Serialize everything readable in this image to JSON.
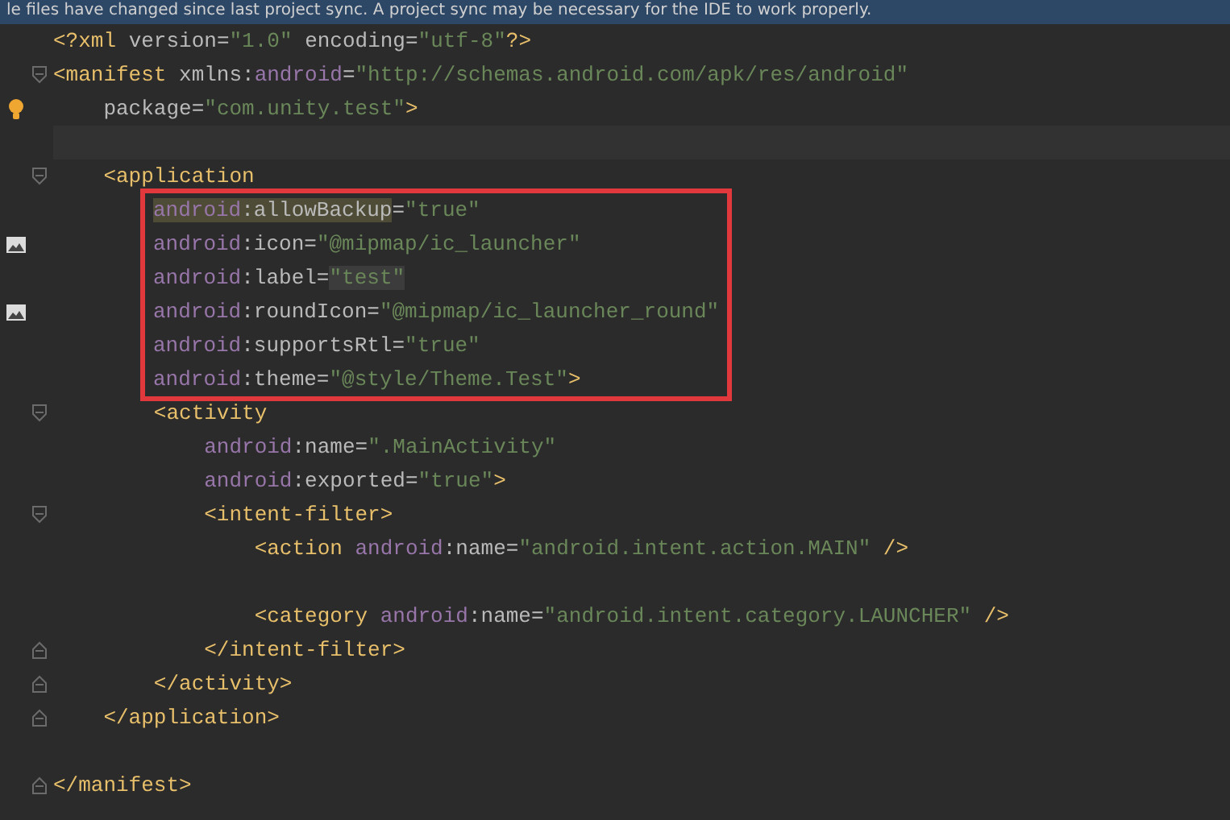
{
  "notification": {
    "text": "le files have changed since last project sync. A project sync may be necessary for the IDE to work properly."
  },
  "sections": [
    {
      "lines": [
        {
          "tokens": [
            {
              "kind": "tag",
              "text": "<?xml"
            },
            {
              "kind": "attr",
              "text": " version"
            },
            {
              "kind": "punct",
              "text": "="
            },
            {
              "kind": "value",
              "text": "\"1.0\""
            },
            {
              "kind": "attr",
              "text": " encoding"
            },
            {
              "kind": "punct",
              "text": "="
            },
            {
              "kind": "value",
              "text": "\"utf-8\""
            },
            {
              "kind": "tag",
              "text": "?>"
            }
          ]
        },
        {
          "fold": {
            "kind": "open"
          },
          "tokens": [
            {
              "kind": "tag",
              "text": "<manifest"
            },
            {
              "kind": "attr",
              "text": " xmlns:"
            },
            {
              "kind": "ns",
              "text": "android"
            },
            {
              "kind": "punct",
              "text": "="
            },
            {
              "kind": "value",
              "text": "\"http://schemas.android.com/apk/res/android\""
            }
          ]
        },
        {
          "gutter": {
            "kind": "bulb"
          },
          "tokens": [
            {
              "kind": "attr",
              "text": "    package"
            },
            {
              "kind": "punct",
              "text": "="
            },
            {
              "kind": "value",
              "text": "\"com.unity.test\""
            },
            {
              "kind": "tag",
              "text": ">"
            }
          ]
        },
        {
          "current": true
        },
        {
          "fold": {
            "kind": "open"
          },
          "tokens": [
            {
              "kind": "tag",
              "text": "    <application"
            }
          ]
        }
      ]
    },
    {
      "boxed": true,
      "lines": [
        {
          "tokens": [
            {
              "kind": "ns",
              "text": "android",
              "highlight": true
            },
            {
              "kind": "attr",
              "text": ":allowBackup",
              "highlight": true
            },
            {
              "kind": "punct",
              "text": "="
            },
            {
              "kind": "value",
              "text": "\"true\""
            }
          ]
        },
        {
          "gutter": {
            "kind": "image"
          },
          "tokens": [
            {
              "kind": "ns",
              "text": "android"
            },
            {
              "kind": "attr",
              "text": ":icon"
            },
            {
              "kind": "punct",
              "text": "="
            },
            {
              "kind": "value",
              "text": "\"@mipmap/ic_launcher\""
            }
          ]
        },
        {
          "tokens": [
            {
              "kind": "ns",
              "text": "android"
            },
            {
              "kind": "attr",
              "text": ":label"
            },
            {
              "kind": "punct",
              "text": "="
            },
            {
              "kind": "value",
              "text": "\"test\"",
              "highlight": true
            }
          ]
        },
        {
          "gutter": {
            "kind": "image"
          },
          "tokens": [
            {
              "kind": "ns",
              "text": "android"
            },
            {
              "kind": "attr",
              "text": ":roundIcon"
            },
            {
              "kind": "punct",
              "text": "="
            },
            {
              "kind": "value",
              "text": "\"@mipmap/ic_launcher_round\""
            }
          ]
        },
        {
          "tokens": [
            {
              "kind": "ns",
              "text": "android"
            },
            {
              "kind": "attr",
              "text": ":supportsRtl"
            },
            {
              "kind": "punct",
              "text": "="
            },
            {
              "kind": "value",
              "text": "\"true\""
            }
          ]
        },
        {
          "tokens": [
            {
              "kind": "ns",
              "text": "android"
            },
            {
              "kind": "attr",
              "text": ":theme"
            },
            {
              "kind": "punct",
              "text": "="
            },
            {
              "kind": "value",
              "text": "\"@style/Theme.Test\""
            },
            {
              "kind": "tag",
              "text": ">"
            }
          ]
        }
      ]
    },
    {
      "lines": [
        {
          "fold": {
            "kind": "open"
          },
          "tokens": [
            {
              "kind": "tag",
              "text": "        <activity"
            }
          ]
        },
        {
          "tokens": [
            {
              "kind": "ns",
              "text": "            android"
            },
            {
              "kind": "attr",
              "text": ":name"
            },
            {
              "kind": "punct",
              "text": "="
            },
            {
              "kind": "value",
              "text": "\".MainActivity\""
            }
          ]
        },
        {
          "tokens": [
            {
              "kind": "ns",
              "text": "            android"
            },
            {
              "kind": "attr",
              "text": ":exported"
            },
            {
              "kind": "punct",
              "text": "="
            },
            {
              "kind": "value",
              "text": "\"true\""
            },
            {
              "kind": "tag",
              "text": ">"
            }
          ]
        },
        {
          "fold": {
            "kind": "open"
          },
          "tokens": [
            {
              "kind": "tag",
              "text": "            <intent-filter>"
            }
          ]
        },
        {
          "tokens": [
            {
              "kind": "tag",
              "text": "                <action"
            },
            {
              "kind": "ns",
              "text": " android"
            },
            {
              "kind": "attr",
              "text": ":name"
            },
            {
              "kind": "punct",
              "text": "="
            },
            {
              "kind": "value",
              "text": "\"android.intent.action.MAIN\""
            },
            {
              "kind": "tag",
              "text": " />"
            }
          ]
        },
        {
          "gap_before": true,
          "tokens": [
            {
              "kind": "tag",
              "text": "                <category"
            },
            {
              "kind": "ns",
              "text": " android"
            },
            {
              "kind": "attr",
              "text": ":name"
            },
            {
              "kind": "punct",
              "text": "="
            },
            {
              "kind": "value",
              "text": "\"android.intent.category.LAUNCHER\""
            },
            {
              "kind": "tag",
              "text": " />"
            }
          ]
        },
        {
          "fold": {
            "kind": "close"
          },
          "tokens": [
            {
              "kind": "tag",
              "text": "            </intent-filter>"
            }
          ]
        },
        {
          "fold": {
            "kind": "close"
          },
          "tokens": [
            {
              "kind": "tag",
              "text": "        </activity>"
            }
          ]
        },
        {
          "fold": {
            "kind": "close"
          },
          "tokens": [
            {
              "kind": "tag",
              "text": "    </application>"
            }
          ]
        },
        {
          "gap_before": true,
          "fold": {
            "kind": "close"
          },
          "tokens": [
            {
              "kind": "tag",
              "text": "</manifest>"
            }
          ]
        }
      ]
    }
  ]
}
